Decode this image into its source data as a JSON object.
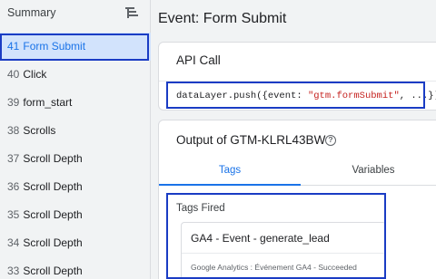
{
  "sidebar": {
    "title": "Summary",
    "clear_icon": "clear-all-icon",
    "items": [
      {
        "num": "41",
        "label": "Form Submit",
        "selected": true
      },
      {
        "num": "40",
        "label": "Click"
      },
      {
        "num": "39",
        "label": "form_start"
      },
      {
        "num": "38",
        "label": "Scrolls"
      },
      {
        "num": "37",
        "label": "Scroll Depth"
      },
      {
        "num": "36",
        "label": "Scroll Depth"
      },
      {
        "num": "35",
        "label": "Scroll Depth"
      },
      {
        "num": "34",
        "label": "Scroll Depth"
      },
      {
        "num": "33",
        "label": "Scroll Depth"
      }
    ]
  },
  "main": {
    "event_title": "Event: Form Submit",
    "api_call": {
      "title": "API Call",
      "code_prefix": "dataLayer.push({event: ",
      "code_string": "\"gtm.formSubmit\"",
      "code_suffix": ", ...})"
    },
    "output": {
      "title": "Output of GTM-KLRL43BW",
      "help_icon": "help-icon",
      "tabs": [
        {
          "label": "Tags",
          "active": true
        },
        {
          "label": "Variables"
        }
      ],
      "tags_fired_label": "Tags Fired",
      "tag": {
        "name": "GA4 - Event - generate_lead",
        "description": "Google Analytics : Événement GA4 - Succeeded"
      }
    }
  },
  "colors": {
    "highlight_box": "#1a3cc4",
    "accent": "#1a73e8",
    "selected_bg": "#d2e3fc",
    "code_string": "#c5221f"
  }
}
